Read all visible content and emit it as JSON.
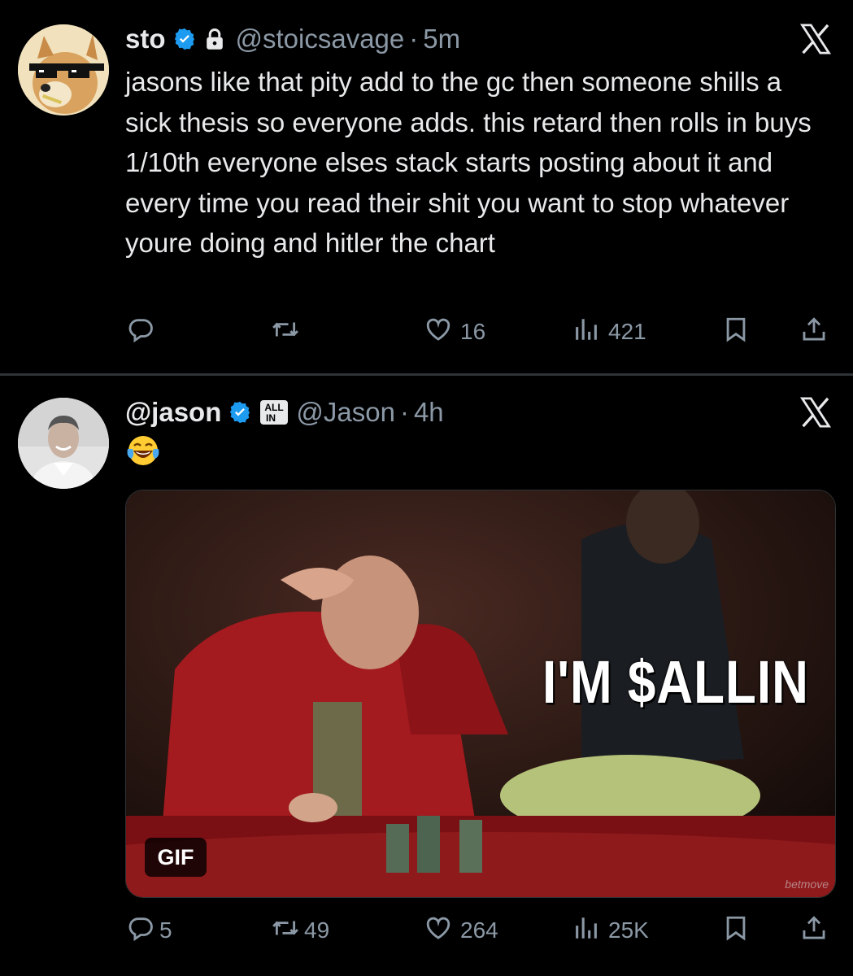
{
  "tweets": [
    {
      "author_name": "sto",
      "handle": "@stoicsavage",
      "separator": "·",
      "time": "5m",
      "text": "jasons like that pity add to the gc then someone shills a sick thesis so everyone adds. this retard then rolls in buys 1/10th everyone elses stack starts posting about it and every time you read their shit you want to stop whatever youre doing and hitler the chart",
      "replies": "",
      "retweets": "",
      "likes": "16",
      "views": "421"
    },
    {
      "author_name": "@jason",
      "handle": "@Jason",
      "separator": "·",
      "time": "4h",
      "badge_text_top": "ALL",
      "badge_text_bottom": "IN",
      "media": {
        "caption": "I'M $ALLIN",
        "badge": "GIF",
        "watermark": "betmove"
      },
      "replies": "5",
      "retweets": "49",
      "likes": "264",
      "views": "25K"
    }
  ],
  "colors": {
    "background": "#000000",
    "text": "#e7e9ea",
    "muted": "#8b98a5",
    "verified": "#1d9bf0",
    "divider": "#2f3336"
  },
  "icons": [
    "verified-badge-icon",
    "lock-icon",
    "x-logo-icon",
    "reply-icon",
    "retweet-icon",
    "like-icon",
    "views-icon",
    "bookmark-icon",
    "share-icon",
    "laughing-emoji-icon",
    "all-in-badge-icon"
  ]
}
